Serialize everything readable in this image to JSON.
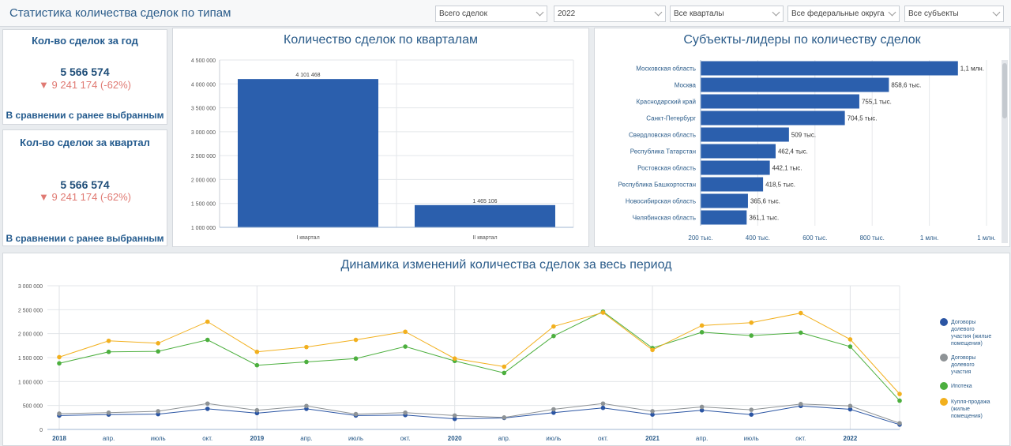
{
  "header": {
    "title": "Статистика количества сделок по типам",
    "filters": [
      {
        "value": "Всего сделок"
      },
      {
        "value": "2022"
      },
      {
        "value": "Все кварталы"
      },
      {
        "value": "Все федеральные округа"
      },
      {
        "value": "Все субъекты"
      }
    ]
  },
  "kpi_year": {
    "title": "Кол-во сделок за год",
    "value": "5 566 574",
    "delta_arrow": "▼",
    "delta": "9 241 174 (-62%)",
    "footer": "В сравнении с ранее выбранным"
  },
  "kpi_quarter": {
    "title": "Кол-во сделок за квартал",
    "value": "5 566 574",
    "delta_arrow": "▼",
    "delta": "9 241 174 (-62%)",
    "footer": "В сравнении с ранее выбранным"
  },
  "charts": {
    "quarters_title": "Количество сделок по кварталам",
    "leaders_title": "Субъекты-лидеры по количеству сделок",
    "dynamics_title": "Динамика изменений количества сделок за весь период"
  },
  "colors": {
    "bar": "#2b5fad",
    "dolevye_zhilye": "#2b55a3",
    "dolevye": "#8e9396",
    "ipoteka": "#4caf3e",
    "kuplya": "#f2b01e"
  },
  "chart_data": [
    {
      "type": "bar",
      "categories": [
        "I квартал",
        "II квартал"
      ],
      "values": [
        4101468,
        1465106
      ],
      "value_labels": [
        "4 101 468",
        "1 465 106"
      ],
      "ylim": [
        1000000,
        4500000
      ],
      "yticks": [
        "1 000 000",
        "1 500 000",
        "2 000 000",
        "2 500 000",
        "3 000 000",
        "3 500 000",
        "4 000 000",
        "4 500 000"
      ],
      "grid": true
    },
    {
      "type": "bar",
      "orientation": "horizontal",
      "categories": [
        "Московская область",
        "Москва",
        "Краснодарский край",
        "Санкт-Петербург",
        "Свердловская область",
        "Республика Татарстан",
        "Ростовская область",
        "Республика Башкортостан",
        "Новосибирская область",
        "Челябинская область"
      ],
      "values": [
        1100000,
        858600,
        755100,
        704500,
        509000,
        462400,
        442100,
        418500,
        365600,
        361100
      ],
      "value_labels": [
        "1,1 млн.",
        "858,6 тыс.",
        "755,1 тыс.",
        "704,5 тыс.",
        "509 тыс.",
        "462,4 тыс.",
        "442,1 тыс.",
        "418,5 тыс.",
        "365,6 тыс.",
        "361,1 тыс."
      ],
      "xlim": [
        200000,
        1200000
      ],
      "xticks": [
        "200 тыс.",
        "400 тыс.",
        "600 тыс.",
        "800 тыс.",
        "1 млн.",
        "1 млн."
      ],
      "grid": true
    },
    {
      "type": "line",
      "x": [
        "2018",
        "апр.",
        "июль",
        "окт.",
        "2019",
        "апр.",
        "июль",
        "окт.",
        "2020",
        "апр.",
        "июль",
        "окт.",
        "2021",
        "апр.",
        "июль",
        "окт.",
        "2022",
        ""
      ],
      "year_labels": [
        "2018",
        "2019",
        "2020",
        "2021",
        "2022"
      ],
      "ylim": [
        0,
        3000000
      ],
      "yticks": [
        "0",
        "500 000",
        "1 000 000",
        "1 500 000",
        "2 000 000",
        "2 500 000",
        "3 000 000"
      ],
      "series": [
        {
          "name": "Договоры долевого участия (жилые помещения)",
          "color_key": "dolevye_zhilye",
          "values": [
            290000,
            310000,
            320000,
            430000,
            340000,
            430000,
            290000,
            300000,
            220000,
            240000,
            350000,
            450000,
            310000,
            400000,
            310000,
            490000,
            420000,
            100000
          ]
        },
        {
          "name": "Договоры долевого участия",
          "color_key": "dolevye",
          "values": [
            330000,
            350000,
            380000,
            540000,
            400000,
            490000,
            320000,
            350000,
            290000,
            250000,
            420000,
            540000,
            380000,
            470000,
            410000,
            530000,
            490000,
            130000
          ]
        },
        {
          "name": "Ипотека",
          "color_key": "ipoteka",
          "values": [
            1380000,
            1620000,
            1630000,
            1870000,
            1340000,
            1410000,
            1480000,
            1730000,
            1430000,
            1180000,
            1950000,
            2460000,
            1700000,
            2030000,
            1960000,
            2020000,
            1730000,
            600000
          ]
        },
        {
          "name": "Купля-продажа (жилые помещения)",
          "color_key": "kuplya",
          "values": [
            1510000,
            1850000,
            1800000,
            2250000,
            1620000,
            1720000,
            1870000,
            2040000,
            1480000,
            1310000,
            2150000,
            2440000,
            1660000,
            2170000,
            2230000,
            2430000,
            1880000,
            740000
          ]
        }
      ],
      "legend": "right",
      "grid": true
    }
  ]
}
